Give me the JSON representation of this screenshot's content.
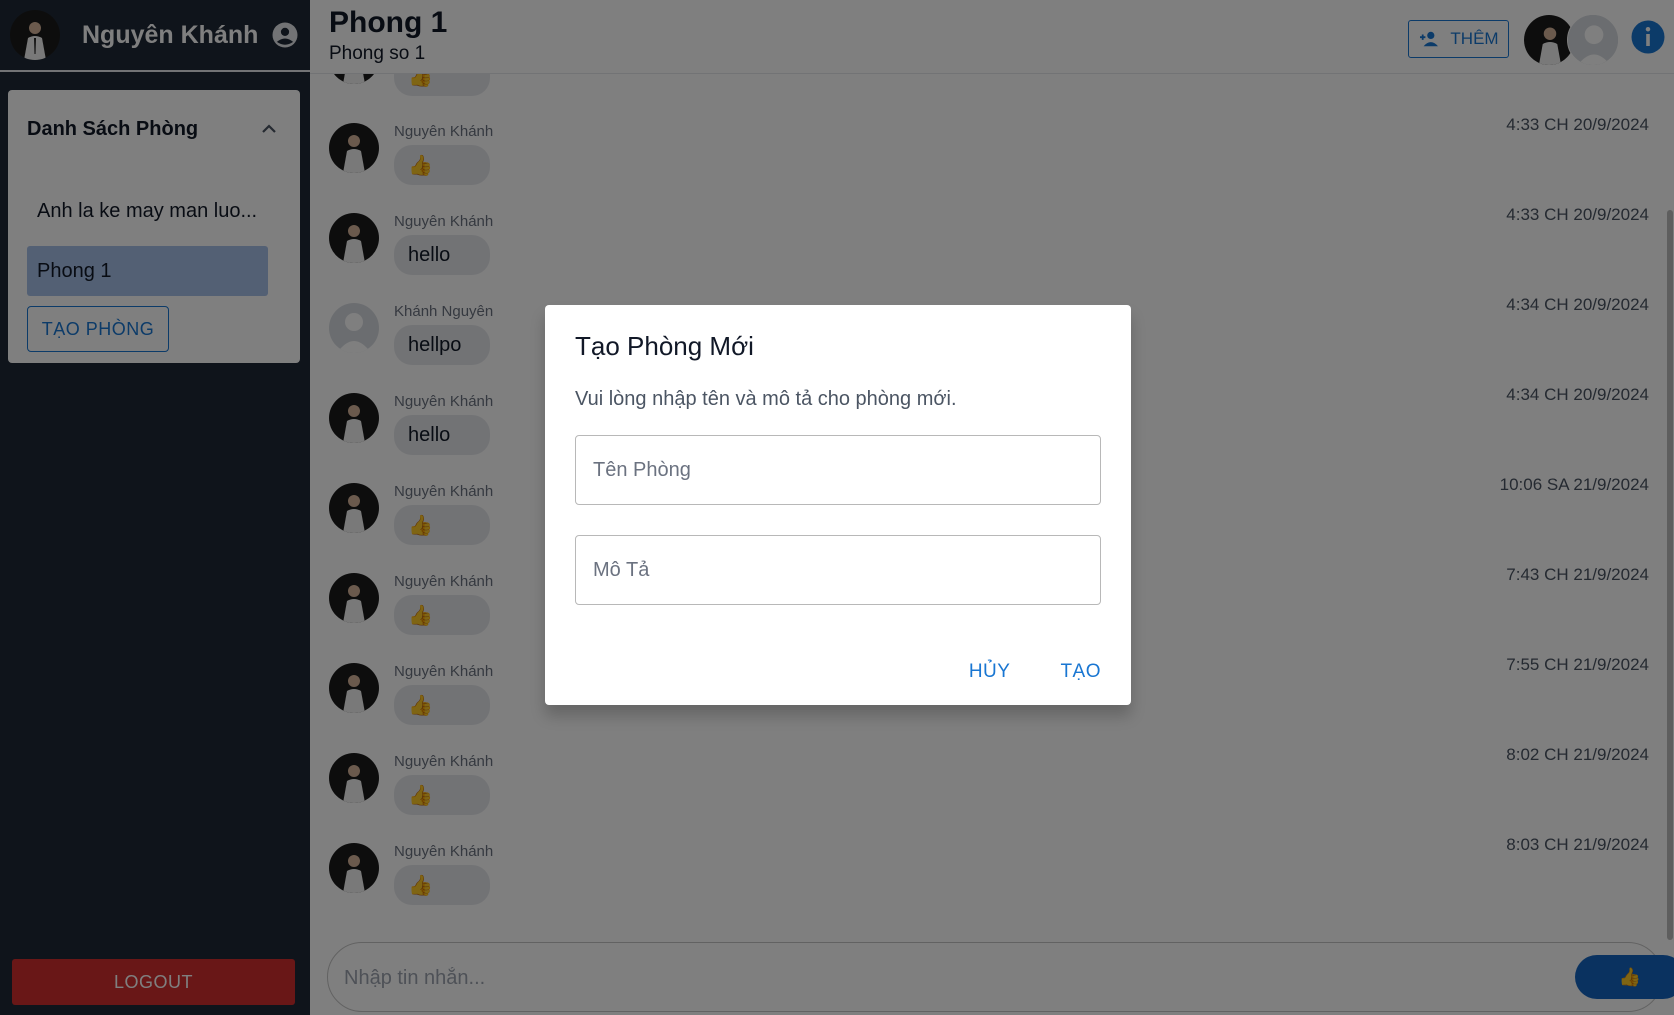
{
  "sidebar": {
    "user_name": "Nguyên Khánh",
    "panel_title": "Danh Sách Phòng",
    "rooms": [
      {
        "label": "Anh la ke may man luo..."
      },
      {
        "label": "Phong 1"
      }
    ],
    "create_room_label": "TẠO PHÒNG",
    "logout_label": "LOGOUT"
  },
  "header": {
    "room_title": "Phong 1",
    "room_description": "Phong so 1",
    "add_label": "THÊM"
  },
  "messages": [
    {
      "name": "",
      "text": "👍",
      "time": "",
      "avatar": "photo"
    },
    {
      "name": "Nguyên Khánh",
      "text": "👍",
      "time": "4:33 CH 20/9/2024",
      "avatar": "photo"
    },
    {
      "name": "Nguyên Khánh",
      "text": "hello",
      "time": "4:33 CH 20/9/2024",
      "avatar": "photo"
    },
    {
      "name": "Khánh Nguyên",
      "text": "hellpo",
      "time": "4:34 CH 20/9/2024",
      "avatar": "default"
    },
    {
      "name": "Nguyên Khánh",
      "text": "hello",
      "time": "4:34 CH 20/9/2024",
      "avatar": "photo"
    },
    {
      "name": "Nguyên Khánh",
      "text": "👍",
      "time": "10:06 SA 21/9/2024",
      "avatar": "photo"
    },
    {
      "name": "Nguyên Khánh",
      "text": "👍",
      "time": "7:43 CH 21/9/2024",
      "avatar": "photo"
    },
    {
      "name": "Nguyên Khánh",
      "text": "👍",
      "time": "7:55 CH 21/9/2024",
      "avatar": "photo"
    },
    {
      "name": "Nguyên Khánh",
      "text": "👍",
      "time": "8:02 CH 21/9/2024",
      "avatar": "photo"
    },
    {
      "name": "Nguyên Khánh",
      "text": "👍",
      "time": "8:03 CH 21/9/2024",
      "avatar": "photo"
    }
  ],
  "composer": {
    "placeholder": "Nhập tin nhắn...",
    "send_glyph": "👍"
  },
  "dialog": {
    "title": "Tạo Phòng Mới",
    "text": "Vui lòng nhập tên và mô tả cho phòng mới.",
    "name_placeholder": "Tên Phòng",
    "desc_placeholder": "Mô Tả",
    "cancel_label": "HỦY",
    "create_label": "TẠO"
  },
  "colors": {
    "sidebar_bg": "#1f2937",
    "accent": "#1976d2",
    "logout": "#d32f2f",
    "active_room": "#a7c0e8"
  },
  "icons": [
    "user-circle-icon",
    "chevron-up-icon",
    "person-add-icon",
    "info-icon",
    "thumbs-up-icon"
  ]
}
